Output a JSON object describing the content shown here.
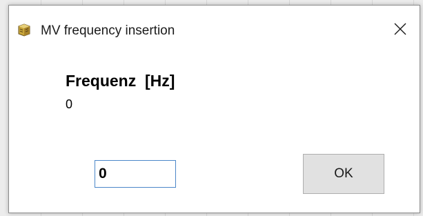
{
  "window": {
    "title": "MV frequency insertion",
    "icon": "app-icon"
  },
  "content": {
    "field_label": "Frequenz  [Hz]",
    "current_value": "0"
  },
  "input": {
    "value": "0"
  },
  "buttons": {
    "ok_label": "OK",
    "close_icon": "close-icon"
  },
  "colors": {
    "input_border_focus": "#4a86c8",
    "button_bg": "#e1e1e1"
  }
}
